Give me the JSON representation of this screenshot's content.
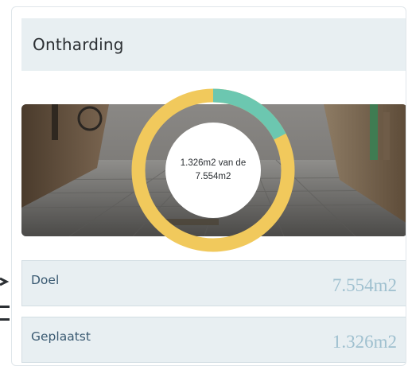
{
  "widget": {
    "title": "Ontharding",
    "progress": {
      "line1": "1.326m2 van de",
      "line2": "7.554m2",
      "placed_value": 1326,
      "goal_value": 7554,
      "fraction": 0.1755,
      "colors": {
        "progress": "#6cc7b0",
        "remaining": "#f1c95c"
      }
    },
    "stats": {
      "goal_label": "Doel",
      "goal_value": "7.554m2",
      "placed_label": "Geplaatst",
      "placed_value": "1.326m2"
    },
    "colors": {
      "panel_background": "#e8eff2",
      "label_text": "#3a5a72",
      "value_text": "#9fc0cf"
    },
    "icons": [
      "background-street-photo"
    ]
  }
}
